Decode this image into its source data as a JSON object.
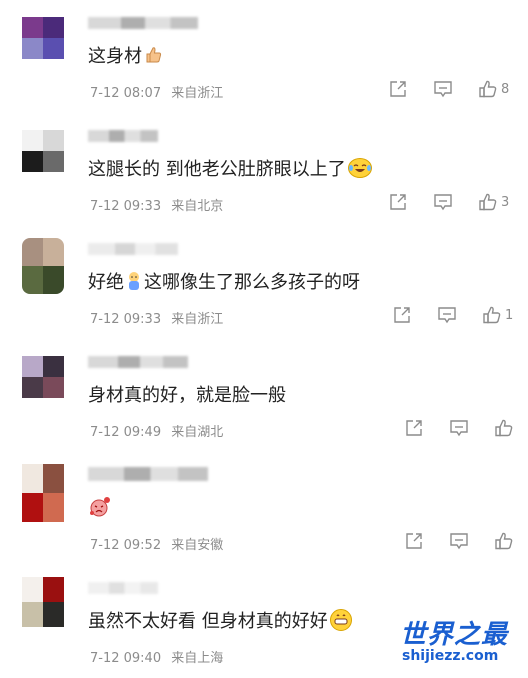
{
  "comments": [
    {
      "text": "这身材",
      "emoji": "thumbs-up-emoji",
      "date": "7-12 08:07",
      "location": "来自浙江",
      "likes": "8",
      "avatar_colors": [
        "#7b3a8c",
        "#4b2a7a",
        "#8b88c8",
        "#5a4fb0"
      ]
    },
    {
      "text": "这腿长的 到他老公肚脐眼以上了",
      "emoji": "laughing-tears-emoji",
      "date": "7-12 09:33",
      "location": "来自北京",
      "likes": "3",
      "avatar_colors": [
        "#f2f2f2",
        "#d8d8d8",
        "#1c1c1c",
        "#6a6a6a"
      ]
    },
    {
      "text": "好绝",
      "emoji": "baby-emoji",
      "text_after": "这哪像生了那么多孩子的呀",
      "date": "7-12 09:33",
      "location": "来自浙江",
      "likes": "1",
      "avatar_colors": [
        "#a89080",
        "#c8b09a",
        "#5a6a40",
        "#3a4a2a"
      ]
    },
    {
      "text": "身材真的好，就是脸一般",
      "emoji": "",
      "date": "7-12 09:49",
      "location": "来自湖北",
      "likes": "",
      "avatar_colors": [
        "#b8a8c8",
        "#3a3040",
        "#4a3a48",
        "#7a4a5a"
      ]
    },
    {
      "text": "",
      "emoji": "crying-face-emoji",
      "date": "7-12 09:52",
      "location": "来自安徽",
      "likes": "",
      "avatar_colors": [
        "#f0e8e0",
        "#8a5040",
        "#b01010",
        "#d06a50"
      ]
    },
    {
      "text": "虽然不太好看 但身材真的好好",
      "emoji": "grinning-emoji",
      "date": "7-12 09:40",
      "location": "来自上海",
      "likes": "",
      "avatar_colors": [
        "#f4f0ec",
        "#9a1010",
        "#c8c0a8",
        "#2a2a28"
      ]
    }
  ],
  "watermark": {
    "title": "世界之最",
    "url": "shijiezz.com"
  },
  "icons": {
    "share": "share-icon",
    "comment": "comment-icon",
    "like": "thumbs-up-icon"
  }
}
